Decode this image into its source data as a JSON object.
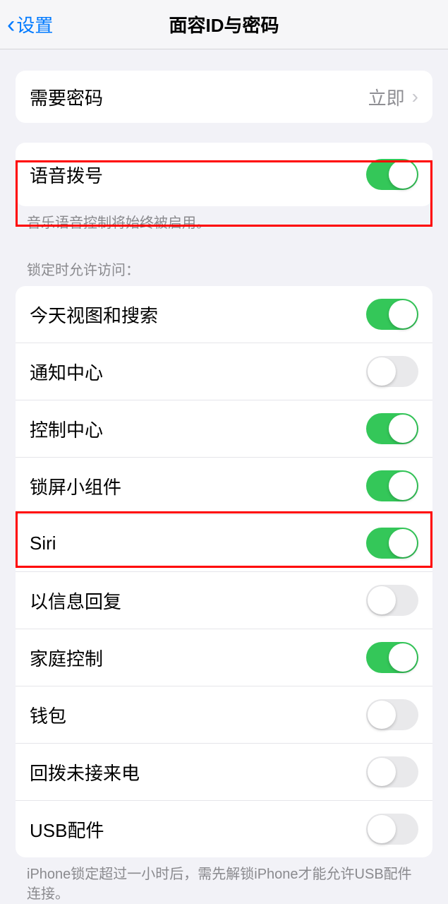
{
  "header": {
    "back_label": "设置",
    "title": "面容ID与密码"
  },
  "require_passcode": {
    "label": "需要密码",
    "value": "立即"
  },
  "voice_dial": {
    "label": "语音拨号",
    "enabled": true,
    "footer": "音乐语音控制将始终被启用。"
  },
  "locked_access": {
    "header": "锁定时允许访问：",
    "items": [
      {
        "label": "今天视图和搜索",
        "enabled": true
      },
      {
        "label": "通知中心",
        "enabled": false
      },
      {
        "label": "控制中心",
        "enabled": true
      },
      {
        "label": "锁屏小组件",
        "enabled": true
      },
      {
        "label": "Siri",
        "enabled": true
      },
      {
        "label": "以信息回复",
        "enabled": false
      },
      {
        "label": "家庭控制",
        "enabled": true
      },
      {
        "label": "钱包",
        "enabled": false
      },
      {
        "label": "回拨未接来电",
        "enabled": false
      },
      {
        "label": "USB配件",
        "enabled": false
      }
    ],
    "footer": "iPhone锁定超过一小时后，需先解锁iPhone才能允许USB配件连接。"
  }
}
